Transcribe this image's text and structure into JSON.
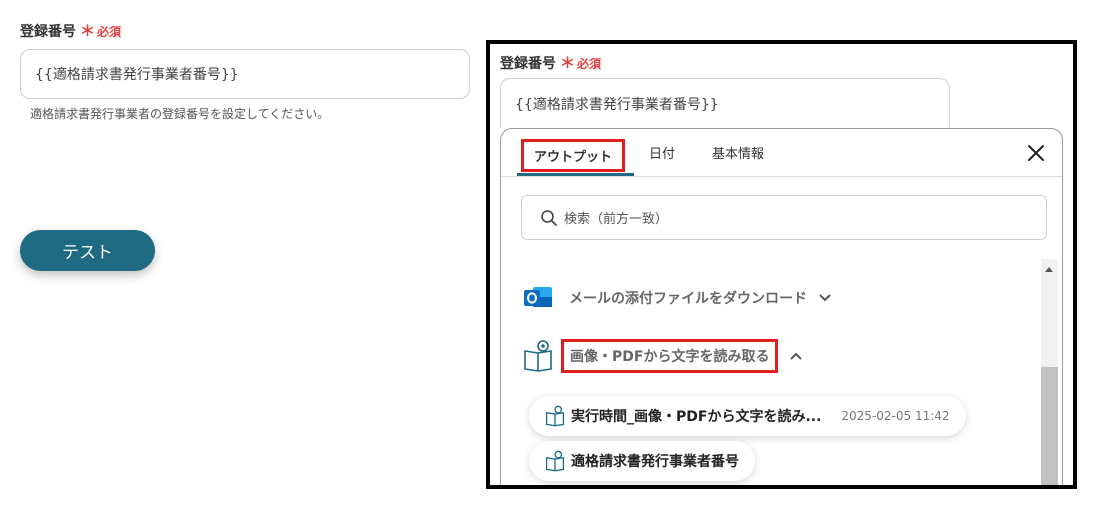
{
  "left_form": {
    "field_label": "登録番号",
    "required_mark": "＊",
    "required_text": "必須",
    "input_value": "{{適格請求書発行事業者番号}}",
    "help_text": "適格請求書発行事業者の登録番号を設定してください。",
    "test_button": "テスト"
  },
  "zoom": {
    "field_label": "登録番号",
    "required_mark": "＊",
    "required_text": "必須",
    "input_value": "{{適格請求書発行事業者番号}}",
    "tabs": [
      "アウトプット",
      "日付",
      "基本情報"
    ],
    "search_placeholder": "検索（前方一致）",
    "groups": [
      {
        "label": "メールの添付ファイルをダウンロード",
        "icon": "outlook-icon",
        "expanded": false
      },
      {
        "label": "画像・PDFから文字を読み取る",
        "icon": "ocr-book-icon",
        "expanded": true
      }
    ],
    "items": [
      {
        "label": "実行時間_画像・PDFから文字を読み...",
        "time": "2025-02-05 11:42"
      },
      {
        "label": "適格請求書発行事業者番号",
        "time": ""
      }
    ],
    "colors": {
      "accent": "#1d6a82",
      "highlight": "#e01f1f",
      "outlook": "#0f6cbd"
    }
  }
}
